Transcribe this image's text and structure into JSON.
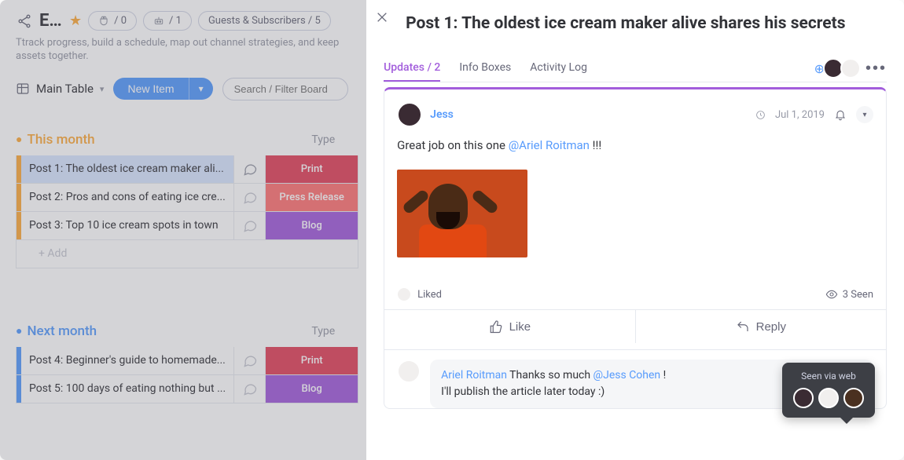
{
  "board": {
    "title": "E...",
    "subtitle": "Ttrack progress, build a schedule, map out channel strategies, and keep assets together.",
    "header_pill1_count": "/ 0",
    "header_pill2_count": "/ 1",
    "guests_pill": "Guests & Subscribers / 5",
    "main_table_label": "Main Table",
    "new_item_label": "New Item",
    "search_placeholder": "Search / Filter Board",
    "add_label": "+ Add",
    "col_type": "Type"
  },
  "groups": [
    {
      "name": "This month",
      "color": "amber",
      "rows": [
        {
          "name": "Post 1: The oldest ice cream maker ali...",
          "type": "Print",
          "type_class": "tc-print",
          "sel": true,
          "chat": "on"
        },
        {
          "name": "Post 2: Pros and cons of eating ice cre...",
          "type": "Press Release",
          "type_class": "tc-press",
          "sel": false,
          "chat": "off"
        },
        {
          "name": "Post 3: Top 10 ice cream spots in town",
          "type": "Blog",
          "type_class": "tc-blog",
          "sel": false,
          "chat": "off"
        }
      ]
    },
    {
      "name": "Next month",
      "color": "blue",
      "rows": [
        {
          "name": "Post 4: Beginner's guide to homemade...",
          "type": "Print",
          "type_class": "tc-print",
          "sel": false,
          "chat": "off"
        },
        {
          "name": "Post 5: 100 days of eating nothing but ...",
          "type": "Blog",
          "type_class": "tc-blog",
          "sel": false,
          "chat": "off"
        }
      ]
    }
  ],
  "panel": {
    "title": "Post 1: The oldest ice cream maker alive shares his secrets",
    "tabs": {
      "updates": "Updates / 2",
      "info": "Info Boxes",
      "log": "Activity Log"
    }
  },
  "update": {
    "author": "Jess",
    "date": "Jul 1, 2019",
    "body_pre": "Great job on this one ",
    "body_mention": "@Ariel Roitman",
    "body_post": " !!!",
    "liked_label": "Liked",
    "seen_label": "3 Seen",
    "like_btn": "Like",
    "reply_btn": "Reply",
    "tooltip": "Seen via web"
  },
  "reply": {
    "name": "Ariel Roitman",
    "text1_pre": " Thanks so much ",
    "text1_mention": "@Jess Cohen",
    "text1_post": " !",
    "text2": "I'll publish the article later today :)"
  }
}
